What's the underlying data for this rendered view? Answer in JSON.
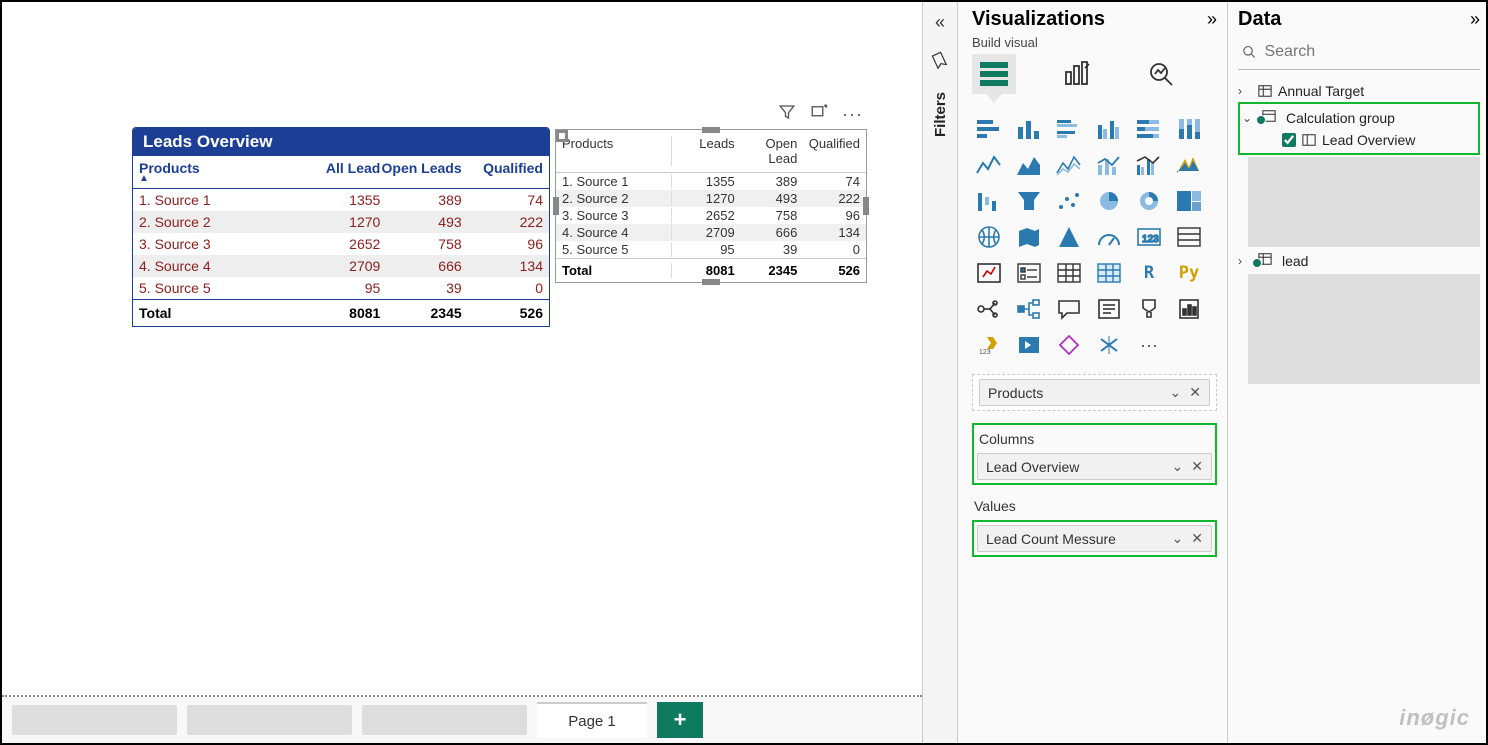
{
  "canvas": {
    "page_tab": "Page 1",
    "blue_table": {
      "title": "Leads Overview",
      "columns": [
        "Products",
        "All Lead",
        "Open Leads",
        "Qualified"
      ],
      "rows": [
        {
          "label": "1. Source 1",
          "all": 1355,
          "open": 389,
          "qual": 74
        },
        {
          "label": "2. Source 2",
          "all": 1270,
          "open": 493,
          "qual": 222
        },
        {
          "label": "3. Source 3",
          "all": 2652,
          "open": 758,
          "qual": 96
        },
        {
          "label": "4. Source 4",
          "all": 2709,
          "open": 666,
          "qual": 134
        },
        {
          "label": "5. Source 5",
          "all": 95,
          "open": 39,
          "qual": 0
        }
      ],
      "total_label": "Total",
      "total": {
        "all": 8081,
        "open": 2345,
        "qual": 526
      }
    },
    "plain_table": {
      "columns": [
        "Products",
        "Leads",
        "Open Lead",
        "Qualified"
      ],
      "rows": [
        {
          "label": "1. Source 1",
          "leads": 1355,
          "open": 389,
          "qual": 74
        },
        {
          "label": "2. Source 2",
          "leads": 1270,
          "open": 493,
          "qual": 222
        },
        {
          "label": "3. Source 3",
          "leads": 2652,
          "open": 758,
          "qual": 96
        },
        {
          "label": "4. Source 4",
          "leads": 2709,
          "open": 666,
          "qual": 134
        },
        {
          "label": "5. Source 5",
          "leads": 95,
          "open": 39,
          "qual": 0
        }
      ],
      "total_label": "Total",
      "total": {
        "leads": 8081,
        "open": 2345,
        "qual": 526
      }
    }
  },
  "filters_label": "Filters",
  "viz": {
    "title": "Visualizations",
    "subtitle": "Build visual",
    "well_rows": {
      "label": "Products"
    },
    "well_columns_header": "Columns",
    "well_columns": {
      "label": "Lead Overview"
    },
    "well_values_header": "Values",
    "well_values": {
      "label": "Lead Count Messure"
    }
  },
  "data": {
    "title": "Data",
    "search_placeholder": "Search",
    "tree": {
      "annual_target": "Annual Target",
      "calc_group": "Calculation group",
      "lead_overview": "Lead Overview",
      "lead": "lead"
    }
  },
  "watermark": "inøgic",
  "chart_data": [
    {
      "type": "table",
      "title": "Leads Overview",
      "columns": [
        "Products",
        "All Lead",
        "Open Leads",
        "Qualified"
      ],
      "rows": [
        [
          "1. Source 1",
          1355,
          389,
          74
        ],
        [
          "2. Source 2",
          1270,
          493,
          222
        ],
        [
          "3. Source 3",
          2652,
          758,
          96
        ],
        [
          "4. Source 4",
          2709,
          666,
          134
        ],
        [
          "5. Source 5",
          95,
          39,
          0
        ]
      ],
      "totals": [
        "Total",
        8081,
        2345,
        526
      ]
    },
    {
      "type": "table",
      "title": "",
      "columns": [
        "Products",
        "Leads",
        "Open Lead",
        "Qualified"
      ],
      "rows": [
        [
          "1. Source 1",
          1355,
          389,
          74
        ],
        [
          "2. Source 2",
          1270,
          493,
          222
        ],
        [
          "3. Source 3",
          2652,
          758,
          96
        ],
        [
          "4. Source 4",
          2709,
          666,
          134
        ],
        [
          "5. Source 5",
          95,
          39,
          0
        ]
      ],
      "totals": [
        "Total",
        8081,
        2345,
        526
      ]
    }
  ]
}
